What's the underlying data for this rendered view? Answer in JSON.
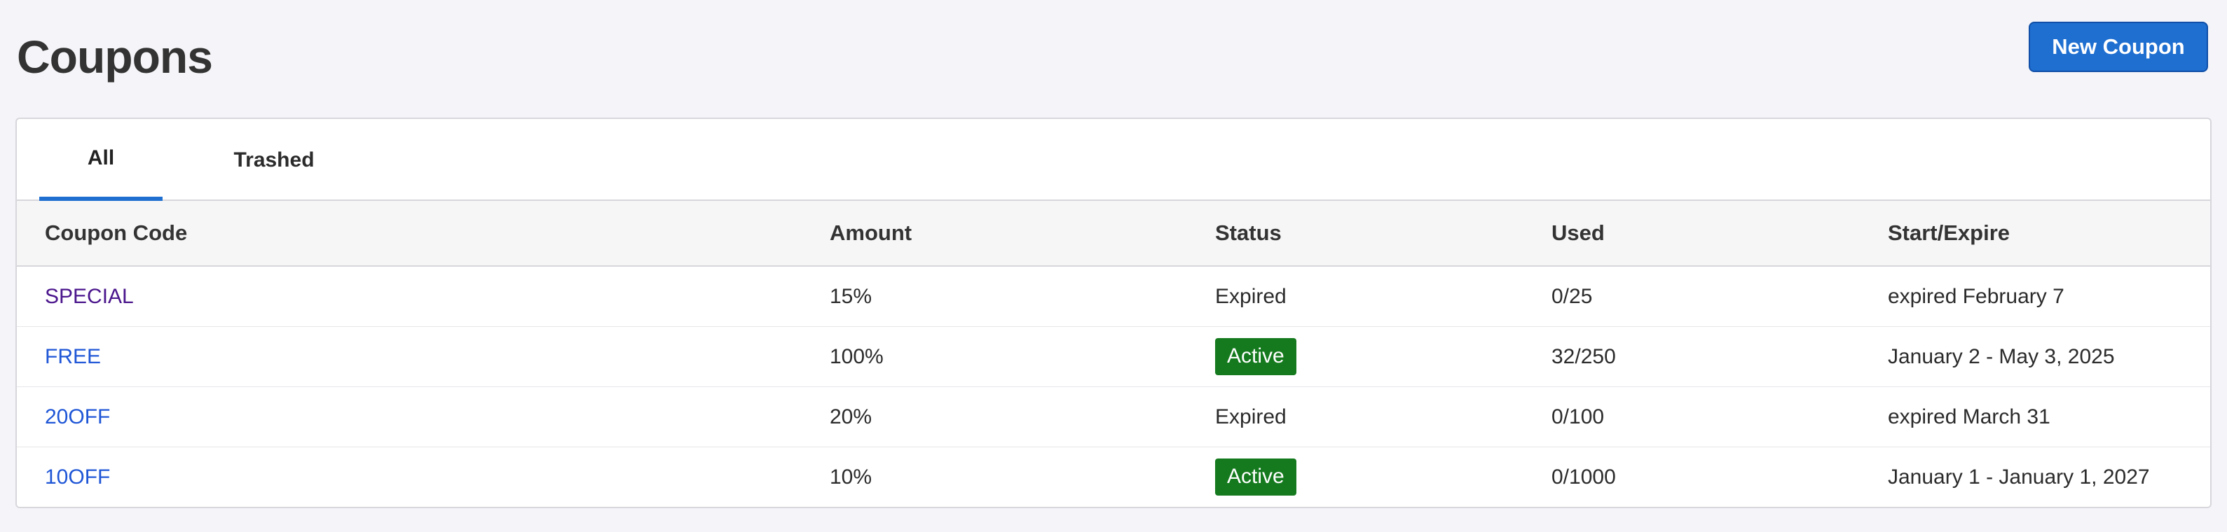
{
  "header": {
    "title": "Coupons",
    "new_button_label": "New Coupon"
  },
  "tabs": [
    {
      "label": "All",
      "active": true
    },
    {
      "label": "Trashed",
      "active": false
    }
  ],
  "table": {
    "columns": [
      "Coupon Code",
      "Amount",
      "Status",
      "Used",
      "Start/Expire"
    ],
    "rows": [
      {
        "code": "SPECIAL",
        "amount": "15%",
        "status": "Expired",
        "used": "0/25",
        "dates": "expired February 7"
      },
      {
        "code": "FREE",
        "amount": "100%",
        "status": "Active",
        "used": "32/250",
        "dates": "January 2 - May 3, 2025"
      },
      {
        "code": "20OFF",
        "amount": "20%",
        "status": "Expired",
        "used": "0/100",
        "dates": "expired March 31"
      },
      {
        "code": "10OFF",
        "amount": "10%",
        "status": "Active",
        "used": "0/1000",
        "dates": "January 1 - January 1, 2027"
      }
    ]
  },
  "colors": {
    "accent": "#1f6fd1",
    "link": "#1f56d6",
    "visited_link": "#4a158c",
    "active_badge": "#157a1e",
    "background": "#f5f5f9"
  }
}
